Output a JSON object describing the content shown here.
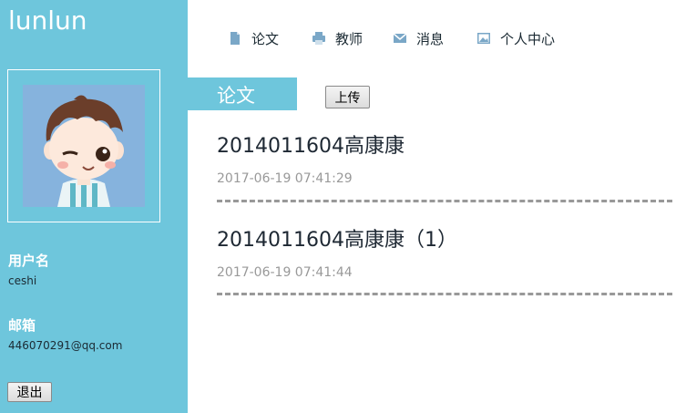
{
  "app": {
    "logo": "lunlun"
  },
  "nav": [
    {
      "label": "论文",
      "icon": "document-icon"
    },
    {
      "label": "教师",
      "icon": "printer-icon"
    },
    {
      "label": "消息",
      "icon": "envelope-icon"
    },
    {
      "label": "个人中心",
      "icon": "picture-icon"
    }
  ],
  "sidebar": {
    "username_label": "用户名",
    "username": "ceshi",
    "email_label": "邮箱",
    "email": "446070291@qq.com",
    "logout_label": "退出"
  },
  "section": {
    "title": "论文",
    "upload_label": "上传"
  },
  "papers": [
    {
      "title": "2014011604高康康",
      "date": "2017-06-19 07:41:29"
    },
    {
      "title": "2014011604高康康（1）",
      "date": "2017-06-19 07:41:44"
    }
  ],
  "colors": {
    "accent": "#6ec6dc",
    "muted": "#999999",
    "text": "#1e2833"
  }
}
